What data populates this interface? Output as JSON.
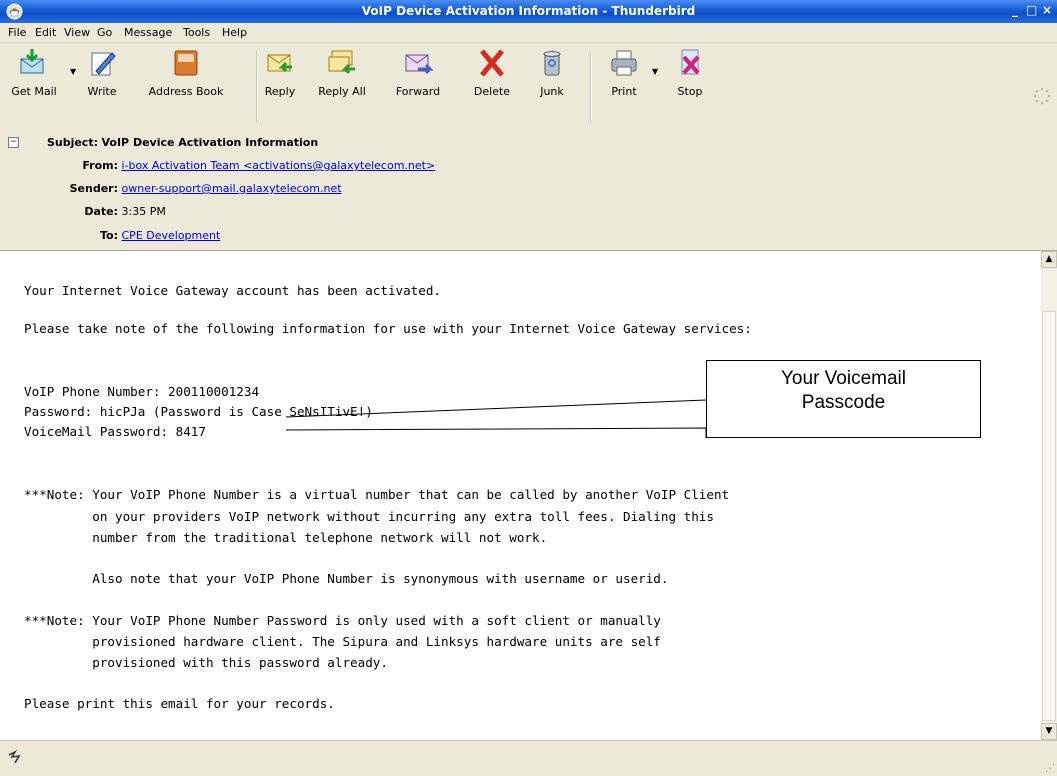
{
  "window": {
    "title": "VoIP Device Activation Information - Thunderbird",
    "controls": [
      "_",
      "□",
      "×"
    ]
  },
  "menu": [
    {
      "label": "File"
    },
    {
      "label": "Edit"
    },
    {
      "label": "View"
    },
    {
      "label": "Go"
    },
    {
      "label": "Message"
    },
    {
      "label": "Tools"
    },
    {
      "label": "Help"
    }
  ],
  "toolbar": {
    "buttons": [
      {
        "label": "Get Mail",
        "icon": "get-mail-icon"
      },
      {
        "label": "Write",
        "icon": "write-icon"
      },
      {
        "label": "Address Book",
        "icon": "address-book-icon"
      },
      {
        "label": "Reply",
        "icon": "reply-icon"
      },
      {
        "label": "Reply All",
        "icon": "reply-all-icon"
      },
      {
        "label": "Forward",
        "icon": "forward-icon"
      },
      {
        "label": "Delete",
        "icon": "delete-icon"
      },
      {
        "label": "Junk",
        "icon": "junk-icon"
      },
      {
        "label": "Print",
        "icon": "print-icon"
      },
      {
        "label": "Stop",
        "icon": "stop-icon"
      }
    ]
  },
  "header": {
    "subject_label": "Subject:",
    "subject": "VoIP Device Activation Information",
    "from_label": "From:",
    "from": "i-box Activation Team <activations@galaxytelecom.net>",
    "sender_label": "Sender:",
    "sender": "owner-support@mail.galaxytelecom.net",
    "date_label": "Date:",
    "date": "3:35 PM",
    "to_label": "To:",
    "to": "CPE Development"
  },
  "body": {
    "line1": "Your Internet Voice Gateway account has been activated.",
    "line2": "Please take note of the following information for use with your Internet Voice Gateway services:",
    "phone": "VoIP Phone Number: 200110001234",
    "password": "Password: hicPJa (Password is Case SeNsITivE!)",
    "voicemail": "VoiceMail Password: 8417",
    "note1_a": "***Note: Your VoIP Phone Number is a virtual number that can be called by another VoIP Client",
    "note1_b": "         on your providers VoIP network without incurring any extra toll fees. Dialing this",
    "note1_c": "         number from the traditional telephone network will not work.",
    "note1_d": "         Also note that your VoIP Phone Number is synonymous with username or userid.",
    "note2_a": "***Note: Your VoIP Phone Number Password is only used with a soft client or manually",
    "note2_b": "         provisioned hardware client. The Sipura and Linksys hardware units are self",
    "note2_c": "         provisioned with this password already.",
    "closing": "Please print this email for your records."
  },
  "callout": {
    "line1": "Your Voicemail",
    "line2": "Passcode"
  },
  "colors": {
    "titlebar": "#1a5fd6",
    "chrome": "#ece9d8",
    "link": "#0000ee"
  }
}
